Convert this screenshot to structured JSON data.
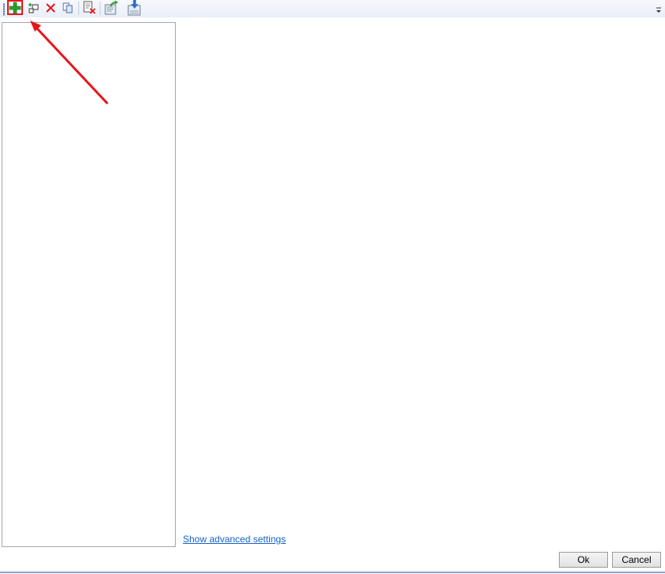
{
  "toolbar": {
    "buttons": [
      {
        "icon": "add-icon",
        "color": "#2ca02c"
      },
      {
        "icon": "add-child-icon"
      },
      {
        "icon": "delete-icon",
        "color": "#e8141b"
      },
      {
        "icon": "copy-icon"
      },
      {
        "icon": "delete-list-icon"
      },
      {
        "icon": "export-icon"
      },
      {
        "icon": "import-icon"
      }
    ],
    "highlighted": "add-icon",
    "highlight_color": "#e8141b"
  },
  "main": {
    "advanced_link": "Show advanced settings"
  },
  "footer": {
    "ok_label": "Ok",
    "cancel_label": "Cancel"
  },
  "colors": {
    "link": "#1463c8",
    "annotation": "#e8141b"
  }
}
